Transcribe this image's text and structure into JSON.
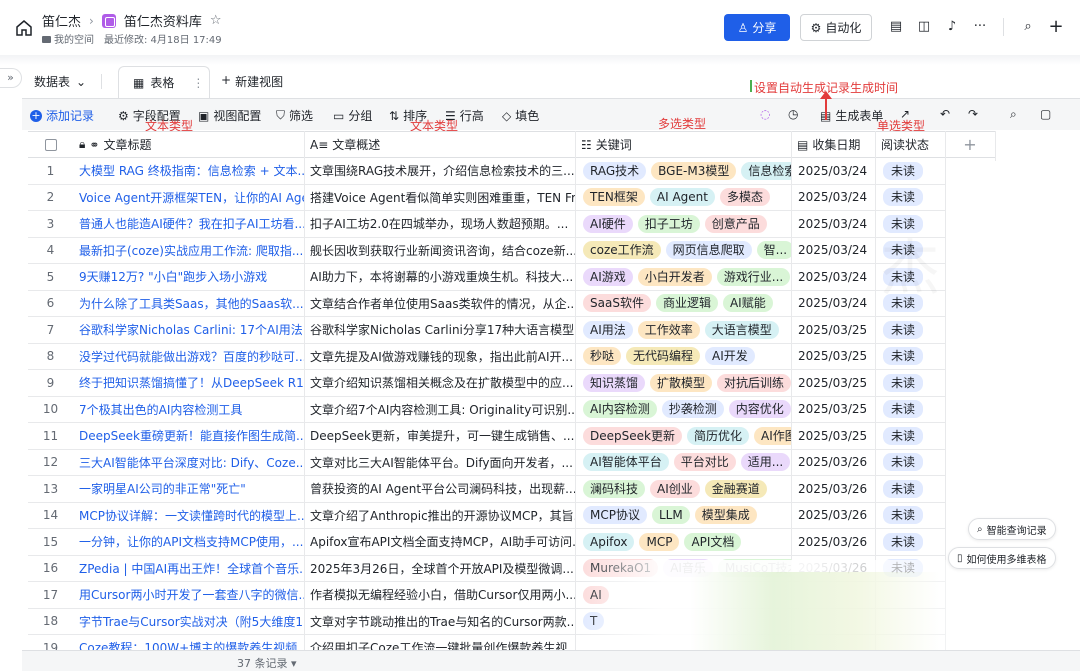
{
  "header": {
    "owner": "笛仁杰",
    "base_name": "笛仁杰资料库",
    "space": "我的空间",
    "modified": "最近修改: 4月18日 17:49",
    "share_label": "分享",
    "automation_label": "自动化"
  },
  "tabs": {
    "datatable": "数据表",
    "grid": "表格",
    "new_view": "新建视图"
  },
  "toolbar": {
    "add_record": "添加记录",
    "field_config": "字段配置",
    "view_config": "视图配置",
    "filter": "筛选",
    "group": "分组",
    "sort": "排序",
    "row_height": "行高",
    "fill_color": "填色",
    "generate_form": "生成表单"
  },
  "annotations": {
    "text_type_1": "文本类型",
    "text_type_2": "文本类型",
    "multi_select": "多选类型",
    "single_select": "单选类型",
    "auto_time": "设置自动生成记录生成时间"
  },
  "columns": {
    "title": "文章标题",
    "summary": "文章概述",
    "keywords": "关键词",
    "date": "收集日期",
    "status": "阅读状态"
  },
  "rows": [
    {
      "n": "1",
      "title": "大模型 RAG 终极指南：信息检索 + 文本...",
      "summary": "文章围绕RAG技术展开，介绍信息检索技术的三...",
      "tags": [
        "RAG技术",
        "BGE-M3模型",
        "信息检索"
      ],
      "date": "2025/03/24",
      "status": "未读"
    },
    {
      "n": "2",
      "title": "Voice Agent开源框架TEN，让你的AI Age...",
      "summary": "搭建Voice Agent看似简单实则困难重重，TEN Fr...",
      "tags": [
        "TEN框架",
        "AI Agent",
        "多模态"
      ],
      "date": "2025/03/24",
      "status": "未读"
    },
    {
      "n": "3",
      "title": "普通人也能造AI硬件？我在扣子AI工坊看...",
      "summary": "扣子AI工坊2.0在四城举办，现场人数超预期。...",
      "tags": [
        "AI硬件",
        "扣子工坊",
        "创意产品"
      ],
      "date": "2025/03/24",
      "status": "未读"
    },
    {
      "n": "4",
      "title": "最新扣子(coze)实战应用工作流: 爬取指...",
      "summary": "舰长因收到获取行业新闻资讯咨询，结合coze新...",
      "tags": [
        "coze工作流",
        "网页信息爬取",
        "智..."
      ],
      "date": "2025/03/24",
      "status": "未读"
    },
    {
      "n": "5",
      "title": "9天赚12万? \"小白\"跑步入场小游戏",
      "summary": "AI助力下，本将谢幕的小游戏重焕生机。科技大...",
      "tags": [
        "AI游戏",
        "小白开发者",
        "游戏行业..."
      ],
      "date": "2025/03/24",
      "status": "未读"
    },
    {
      "n": "6",
      "title": "为什么除了工具类Saas，其他的Saas软...",
      "summary": "文章结合作者单位使用Saas类软件的情况，从企...",
      "tags": [
        "SaaS软件",
        "商业逻辑",
        "AI赋能"
      ],
      "date": "2025/03/24",
      "status": "未读"
    },
    {
      "n": "7",
      "title": "谷歌科学家Nicholas Carlini: 17个AI用法...",
      "summary": "谷歌科学家Nicholas Carlini分享17种大语言模型...",
      "tags": [
        "AI用法",
        "工作效率",
        "大语言模型"
      ],
      "date": "2025/03/25",
      "status": "未读"
    },
    {
      "n": "8",
      "title": "没学过代码就能做出游戏？百度的秒哒可...",
      "summary": "文章先提及AI做游戏赚钱的现象，指出此前AI开...",
      "tags": [
        "秒哒",
        "无代码编程",
        "AI开发"
      ],
      "date": "2025/03/25",
      "status": "未读"
    },
    {
      "n": "9",
      "title": "终于把知识蒸馏搞懂了！从DeepSeek R1...",
      "summary": "文章介绍知识蒸馏相关概念及在扩散模型中的应...",
      "tags": [
        "知识蒸馏",
        "扩散模型",
        "对抗后训练"
      ],
      "date": "2025/03/25",
      "status": "未读"
    },
    {
      "n": "10",
      "title": "7个极其出色的AI内容检测工具",
      "summary": "文章介绍7个AI内容检测工具: Originality可识别...",
      "tags": [
        "AI内容检测",
        "抄袭检测",
        "内容优化"
      ],
      "date": "2025/03/25",
      "status": "未读"
    },
    {
      "n": "11",
      "title": "DeepSeek重磅更新！能直接作图生成简...",
      "summary": "DeepSeek更新，审美提升，可一键生成销售、...",
      "tags": [
        "DeepSeek更新",
        "简历优化",
        "AI作图"
      ],
      "date": "2025/03/25",
      "status": "未读"
    },
    {
      "n": "12",
      "title": "三大AI智能体平台深度对比: Dify、Coze...",
      "summary": "文章对比三大AI智能体平台。Dify面向开发者，...",
      "tags": [
        "AI智能体平台",
        "平台对比",
        "适用..."
      ],
      "date": "2025/03/26",
      "status": "未读"
    },
    {
      "n": "13",
      "title": "一家明星AI公司的非正常\"死亡\"",
      "summary": "曾获投资的AI Agent平台公司澜码科技，出现薪...",
      "tags": [
        "澜码科技",
        "AI创业",
        "金融赛道"
      ],
      "date": "2025/03/26",
      "status": "未读"
    },
    {
      "n": "14",
      "title": "MCP协议详解：一文读懂跨时代的模型上...",
      "summary": "文章介绍了Anthropic推出的开源协议MCP，其旨...",
      "tags": [
        "MCP协议",
        "LLM",
        "模型集成"
      ],
      "date": "2025/03/26",
      "status": "未读"
    },
    {
      "n": "15",
      "title": "一分钟，让你的API文档支持MCP使用，...",
      "summary": "Apifox宣布API文档全面支持MCP，AI助手可访问...",
      "tags": [
        "Apifox",
        "MCP",
        "API文档"
      ],
      "date": "2025/03/26",
      "status": "未读"
    },
    {
      "n": "16",
      "title": "ZPedia | 中国AI再出王炸！全球首个音乐...",
      "summary": "2025年3月26日，全球首个开放API及模型微调...",
      "tags": [
        "MurekaO1",
        "AI音乐",
        "MusiCoT技术"
      ],
      "date": "2025/03/26",
      "status": "未读"
    },
    {
      "n": "17",
      "title": "用Cursor两小时开发了一套查八字的微信...",
      "summary": "作者模拟无编程经验小白，借助Cursor仅用两小...",
      "tags": [
        "AI",
        "",
        ""
      ],
      "date": "",
      "status": ""
    },
    {
      "n": "18",
      "title": "字节Trae与Cursor实战对决（附5大维度1...",
      "summary": "文章对字节跳动推出的Trae与知名的Cursor两款...",
      "tags": [
        "T",
        "",
        ""
      ],
      "date": "",
      "status": ""
    },
    {
      "n": "19",
      "title": "Coze教程：100W+博主的爆款养生视频...",
      "summary": "介绍用扣子Coze工作流一键批量创作爆款养生视...",
      "tags": [
        "",
        "",
        ""
      ],
      "date": "",
      "status": ""
    }
  ],
  "footer": {
    "count": "37 条记录"
  },
  "float": {
    "smart_query": "智能查询记录",
    "how_to": "如何使用多维表格"
  },
  "colors": {
    "accent": "#1f5fe8",
    "annotation": "#e23b3b"
  }
}
